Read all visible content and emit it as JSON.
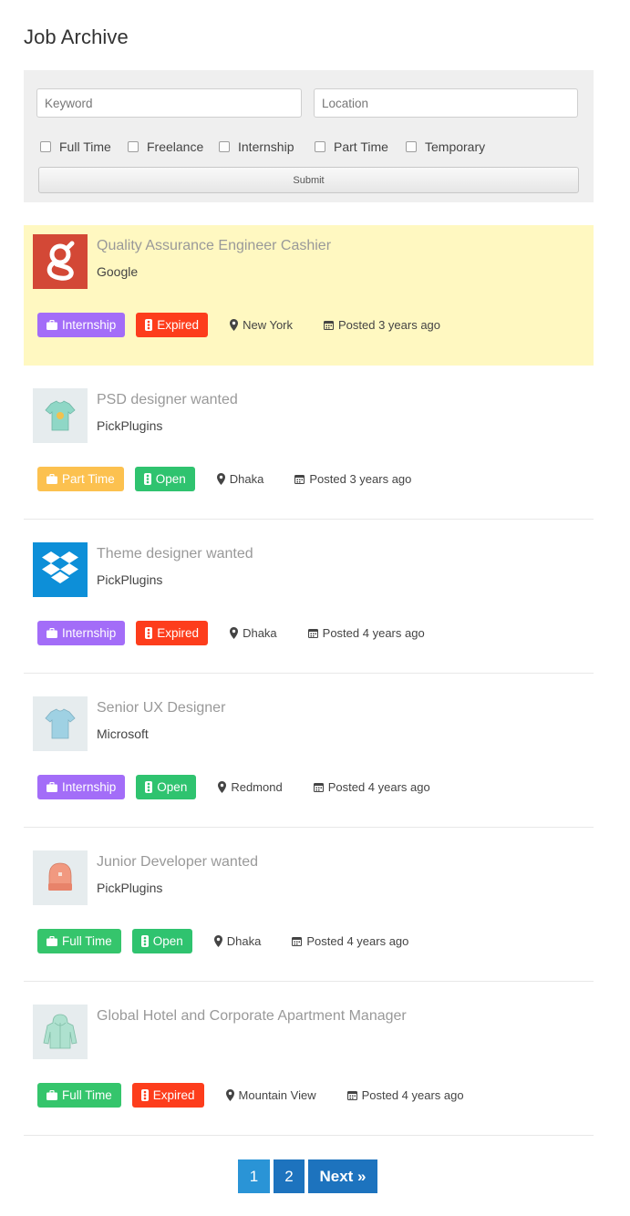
{
  "page": {
    "title": "Job Archive"
  },
  "search": {
    "keyword_placeholder": "Keyword",
    "location_placeholder": "Location",
    "job_types": [
      "Full Time",
      "Freelance",
      "Internship",
      "Part Time",
      "Temporary"
    ],
    "submit_label": "Submit"
  },
  "jobs": [
    {
      "title": "Quality Assurance Engineer Cashier",
      "company": "Google",
      "type": "Internship",
      "status": "Expired",
      "location": "New York",
      "posted": "Posted 3 years ago",
      "logo_icon": "google-logo"
    },
    {
      "title": "PSD designer wanted",
      "company": "PickPlugins",
      "type": "Part Time",
      "status": "Open",
      "location": "Dhaka",
      "posted": "Posted 3 years ago",
      "logo_icon": "tshirt-icon"
    },
    {
      "title": "Theme designer wanted",
      "company": "PickPlugins",
      "type": "Internship",
      "status": "Expired",
      "location": "Dhaka",
      "posted": "Posted 4 years ago",
      "logo_icon": "dropbox-logo"
    },
    {
      "title": "Senior UX Designer",
      "company": "Microsoft",
      "type": "Internship",
      "status": "Open",
      "location": "Redmond",
      "posted": "Posted 4 years ago",
      "logo_icon": "tshirt-icon"
    },
    {
      "title": "Junior Developer wanted",
      "company": "PickPlugins",
      "type": "Full Time",
      "status": "Open",
      "location": "Dhaka",
      "posted": "Posted 4 years ago",
      "logo_icon": "beanie-icon"
    },
    {
      "title": "Global Hotel and Corporate Apartment Manager",
      "company": "",
      "type": "Full Time",
      "status": "Expired",
      "location": "Mountain View",
      "posted": "Posted 4 years ago",
      "logo_icon": "hoodie-icon"
    }
  ],
  "pagination": {
    "pages": [
      "1",
      "2"
    ],
    "current": "1",
    "next_label": "Next »"
  },
  "colors": {
    "featured_bg": "#fff8c1",
    "internship": "#a36df8",
    "part_time": "#fcc14f",
    "full_time": "#35c56c",
    "expired": "#fd3d1c",
    "open": "#2fc36f",
    "pagination": "#1d73be"
  }
}
